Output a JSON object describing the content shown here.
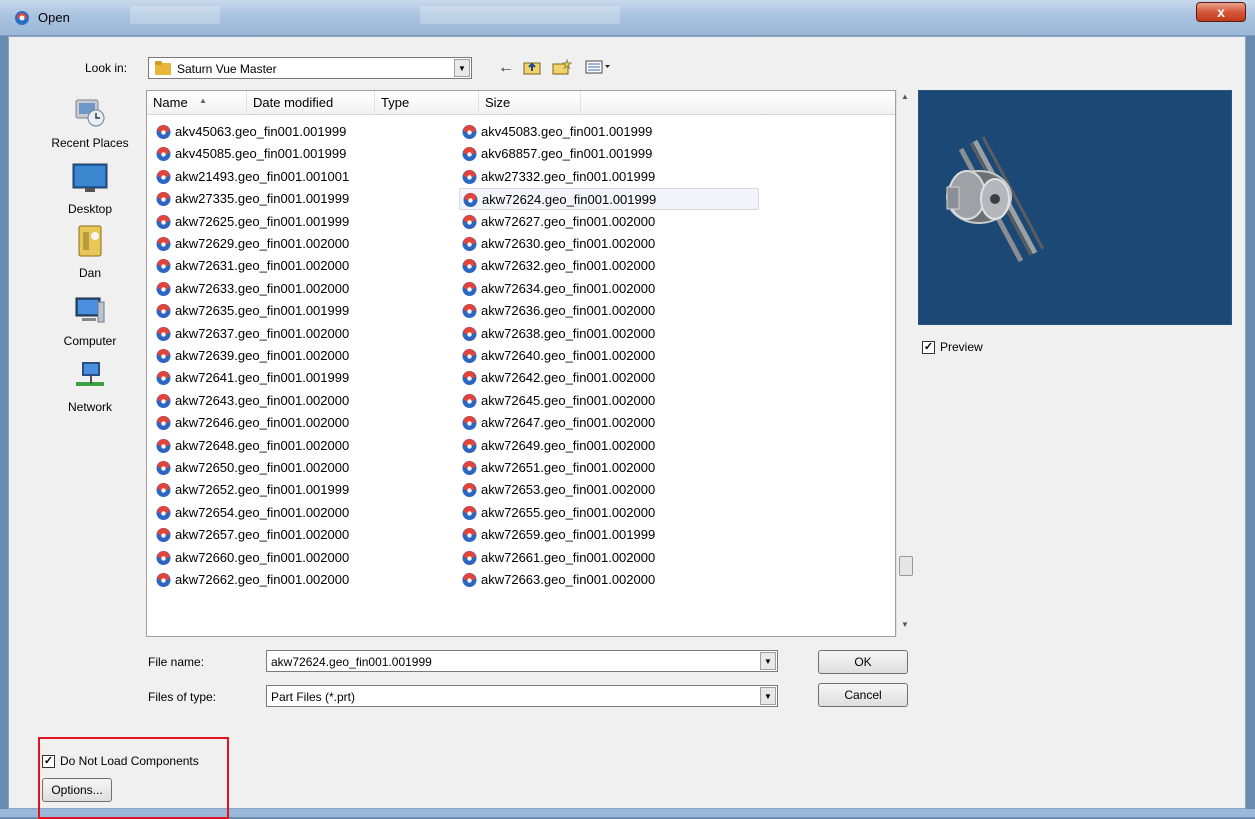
{
  "window": {
    "title": "Open",
    "close_label": "x"
  },
  "toolbar": {
    "look_in_label": "Look in:",
    "look_in_value": "Saturn Vue Master",
    "back_icon": "back-arrow-icon",
    "up_icon": "up-folder-icon",
    "new_folder_icon": "new-folder-icon",
    "views_icon": "views-menu-icon"
  },
  "places": [
    {
      "label": "Recent Places",
      "icon": "recent-places-icon"
    },
    {
      "label": "Desktop",
      "icon": "desktop-icon"
    },
    {
      "label": "Dan",
      "icon": "user-folder-icon"
    },
    {
      "label": "Computer",
      "icon": "computer-icon"
    },
    {
      "label": "Network",
      "icon": "network-icon"
    }
  ],
  "columns": [
    "Name",
    "Date modified",
    "Type",
    "Size"
  ],
  "files_col1": [
    "akv45063.geo_fin001.001999",
    "akv45085.geo_fin001.001999",
    "akw21493.geo_fin001.001001",
    "akw27335.geo_fin001.001999",
    "akw72625.geo_fin001.001999",
    "akw72629.geo_fin001.002000",
    "akw72631.geo_fin001.002000",
    "akw72633.geo_fin001.002000",
    "akw72635.geo_fin001.001999",
    "akw72637.geo_fin001.002000",
    "akw72639.geo_fin001.002000",
    "akw72641.geo_fin001.001999",
    "akw72643.geo_fin001.002000",
    "akw72646.geo_fin001.002000",
    "akw72648.geo_fin001.002000",
    "akw72650.geo_fin001.002000",
    "akw72652.geo_fin001.001999",
    "akw72654.geo_fin001.002000",
    "akw72657.geo_fin001.002000",
    "akw72660.geo_fin001.002000",
    "akw72662.geo_fin001.002000"
  ],
  "files_col2": [
    "akv45083.geo_fin001.001999",
    "akv68857.geo_fin001.001999",
    "akw27332.geo_fin001.001999",
    "akw72624.geo_fin001.001999",
    "akw72627.geo_fin001.002000",
    "akw72630.geo_fin001.002000",
    "akw72632.geo_fin001.002000",
    "akw72634.geo_fin001.002000",
    "akw72636.geo_fin001.002000",
    "akw72638.geo_fin001.002000",
    "akw72640.geo_fin001.002000",
    "akw72642.geo_fin001.002000",
    "akw72645.geo_fin001.002000",
    "akw72647.geo_fin001.002000",
    "akw72649.geo_fin001.002000",
    "akw72651.geo_fin001.002000",
    "akw72653.geo_fin001.002000",
    "akw72655.geo_fin001.002000",
    "akw72659.geo_fin001.001999",
    "akw72661.geo_fin001.002000",
    "akw72663.geo_fin001.002000"
  ],
  "selected_file": "akw72624.geo_fin001.001999",
  "file_name_label": "File name:",
  "file_name_value": "akw72624.geo_fin001.001999",
  "file_type_label": "Files of type:",
  "file_type_value": "Part Files (*.prt)",
  "ok_label": "OK",
  "cancel_label": "Cancel",
  "preview_label": "Preview",
  "preview_checked": true,
  "do_not_load_label": "Do Not Load Components",
  "do_not_load_checked": true,
  "options_label": "Options...",
  "colors": {
    "preview_bg": "#1c4875",
    "highlight_box": "#e0141e",
    "title_bar": "#a9c3df"
  }
}
